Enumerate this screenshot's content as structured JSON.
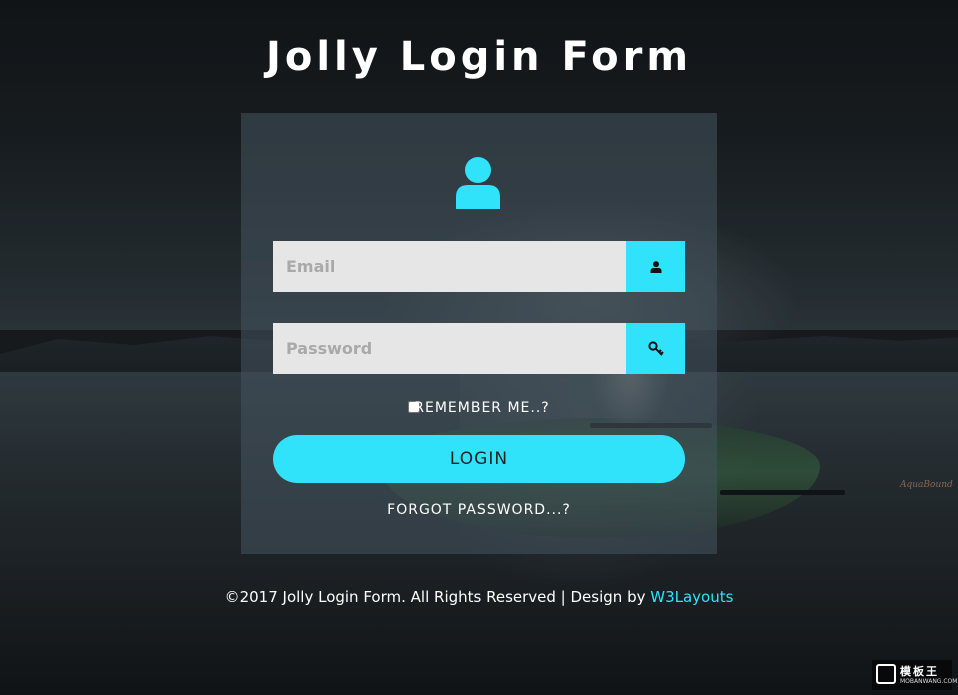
{
  "page": {
    "title": "Jolly Login Form"
  },
  "form": {
    "email_placeholder": "Email",
    "password_placeholder": "Password",
    "remember_label": "REMEMBER ME..?",
    "login_label": "LOGIN",
    "forgot_label": "FORGOT PASSWORD...?"
  },
  "footer": {
    "copyright": "©2017 Jolly Login Form. All Rights Reserved | Design by ",
    "link_label": "W3Layouts"
  },
  "background": {
    "kayak_logo": "AquaBound"
  },
  "watermark": {
    "title": "模板王",
    "subtitle": "MOBANWANG.COM"
  },
  "icons": {
    "avatar": "user-icon",
    "email_button": "user-icon",
    "password_button": "key-icon"
  },
  "colors": {
    "accent": "#31e2fb",
    "input_bg": "#e6e6e6",
    "panel_bg": "rgba(70,84,94,0.55)"
  }
}
